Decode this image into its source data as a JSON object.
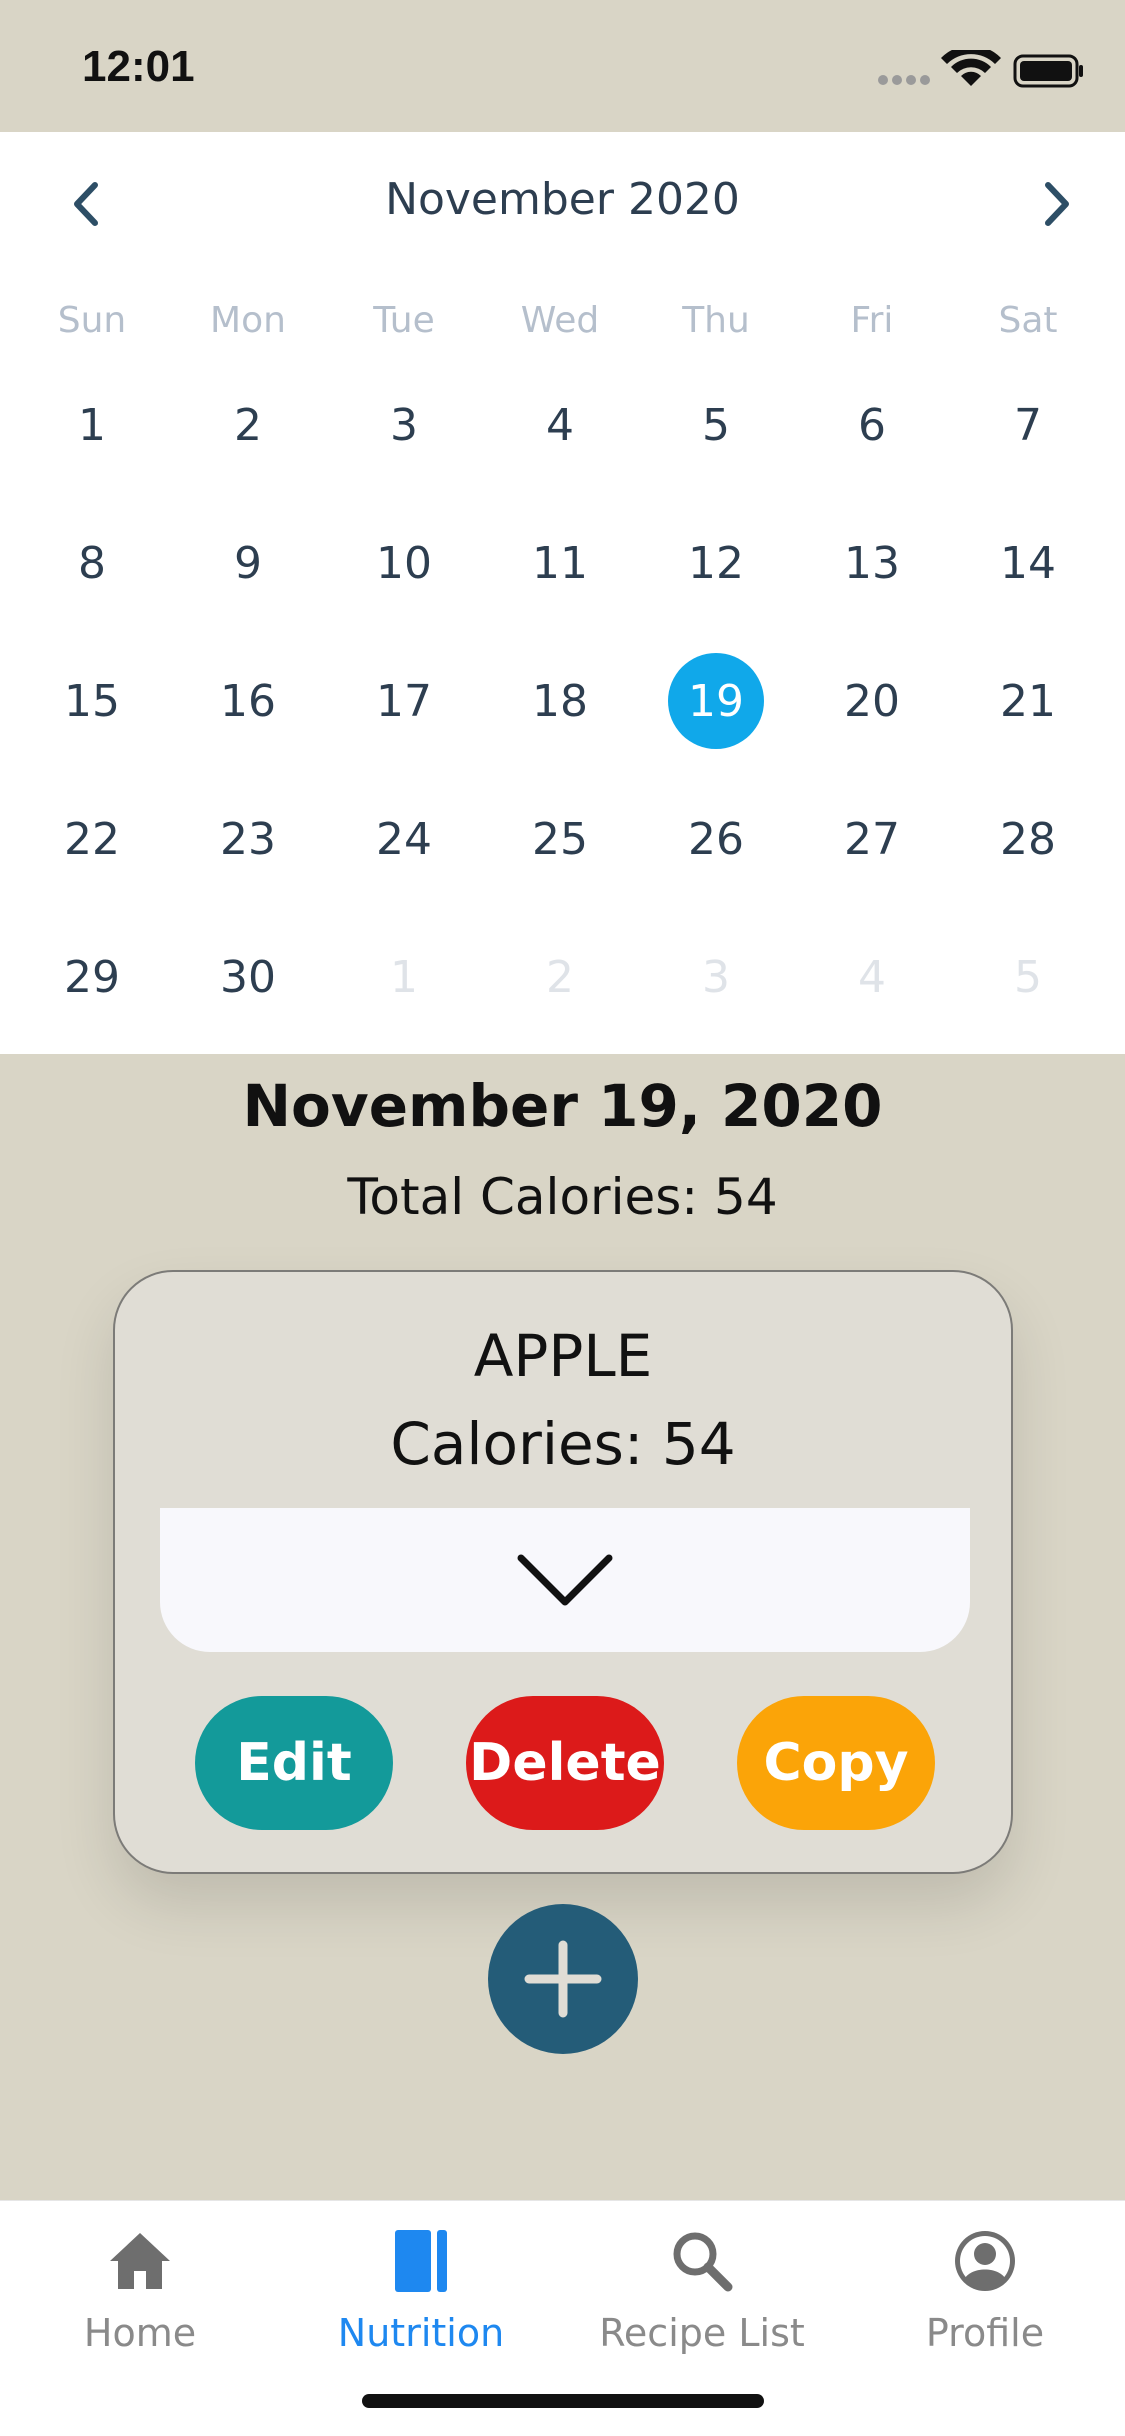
{
  "status_bar": {
    "time": "12:01"
  },
  "calendar": {
    "month_title": "November 2020",
    "weekdays": [
      "Sun",
      "Mon",
      "Tue",
      "Wed",
      "Thu",
      "Fri",
      "Sat"
    ],
    "weeks": [
      [
        "1",
        "2",
        "3",
        "4",
        "5",
        "6",
        "7"
      ],
      [
        "8",
        "9",
        "10",
        "11",
        "12",
        "13",
        "14"
      ],
      [
        "15",
        "16",
        "17",
        "18",
        "19",
        "20",
        "21"
      ],
      [
        "22",
        "23",
        "24",
        "25",
        "26",
        "27",
        "28"
      ],
      [
        "29",
        "30",
        "1",
        "2",
        "3",
        "4",
        "5"
      ]
    ],
    "selected_day": "19",
    "selected_color": "#10a8ea"
  },
  "summary": {
    "date": "November 19, 2020",
    "total_calories": "Total Calories: 54"
  },
  "food_card": {
    "name": "APPLE",
    "calories": "Calories: 54",
    "buttons": {
      "edit": "Edit",
      "delete": "Delete",
      "copy": "Copy"
    },
    "colors": {
      "edit": "#139a9a",
      "delete": "#dc1a1a",
      "copy": "#fba408"
    }
  },
  "fab": {
    "icon": "plus-icon",
    "color": "#245c78"
  },
  "tab_bar": {
    "tabs": [
      {
        "label": "Home",
        "icon": "home-icon"
      },
      {
        "label": "Nutrition",
        "icon": "book-icon"
      },
      {
        "label": "Recipe List",
        "icon": "search-icon"
      },
      {
        "label": "Profile",
        "icon": "profile-icon"
      }
    ],
    "active": "Nutrition",
    "active_color": "#1e88f0"
  }
}
